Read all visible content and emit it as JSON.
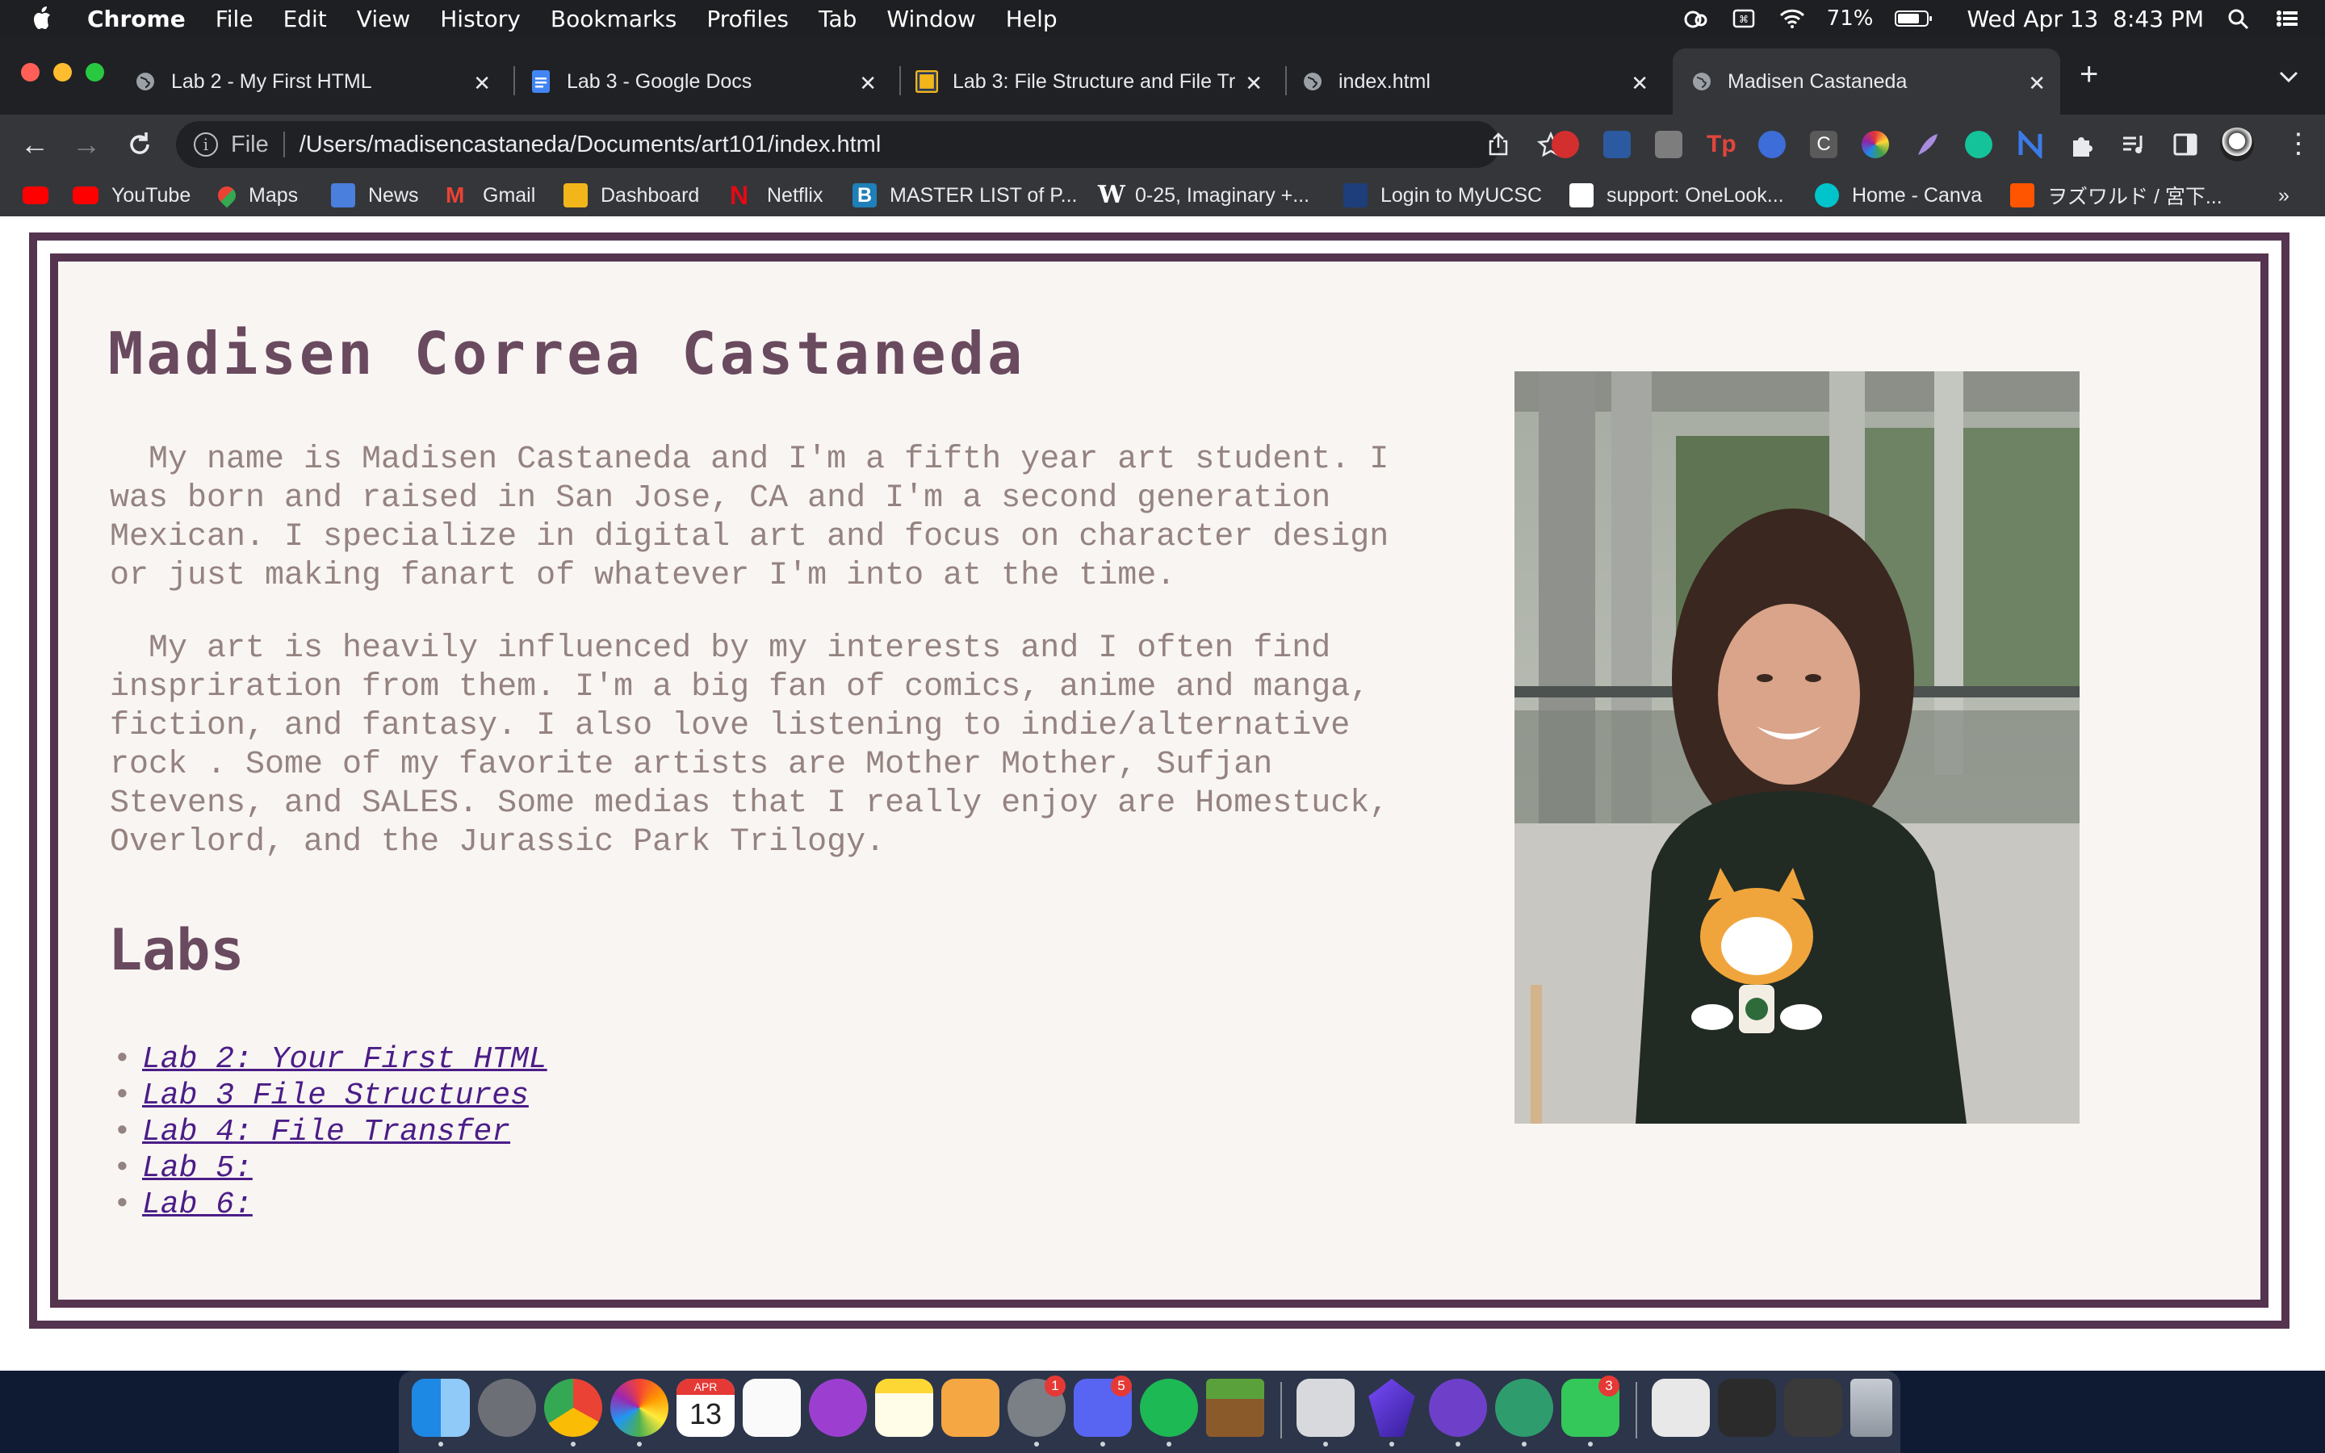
{
  "menubar": {
    "app": "Chrome",
    "items": [
      "File",
      "Edit",
      "View",
      "History",
      "Bookmarks",
      "Profiles",
      "Tab",
      "Window",
      "Help"
    ],
    "battery": "71%",
    "datetime": "Wed Apr 13  8:43 PM"
  },
  "tabs": [
    {
      "title": "Lab 2 - My First HTML",
      "icon": "globe-icon"
    },
    {
      "title": "Lab 3 - Google Docs",
      "icon": "google-docs-icon"
    },
    {
      "title": "Lab 3: File Structure and File Tr",
      "icon": "ucsc-icon"
    },
    {
      "title": "index.html",
      "icon": "globe-icon"
    },
    {
      "title": "Madisen Castaneda",
      "icon": "globe-icon"
    }
  ],
  "omnibox": {
    "scheme": "File",
    "url": "/Users/madisencastaneda/Documents/art101/index.html"
  },
  "bookmarks": [
    "YouTube",
    "Maps",
    "News",
    "Gmail",
    "Dashboard",
    "Netflix",
    "MASTER LIST of P...",
    "0-25, Imaginary +...",
    "Login to MyUCSC",
    "support: OneLook...",
    "Home - Canva",
    "ヲズワルド / 宮下..."
  ],
  "page": {
    "heading": "Madisen Correa Castaneda",
    "para1": "  My name is Madisen Castaneda and I'm a fifth year art student. I\nwas born and raised in San Jose, CA and I'm a second generation\nMexican. I specialize in digital art and focus on character design\nor just making fanart of whatever I'm into at the time.",
    "para2": "  My art is heavily influenced by my interests and I often find\ninspriration from them. I'm a big fan of comics, anime and manga,\nfiction, and fantasy. I also love listening to indie/alternative\nrock . Some of my favorite artists are Mother Mother, Sufjan\nStevens, and SALES. Some medias that I really enjoy are Homestuck,\nOverlord, and the Jurassic Park Trilogy.",
    "labs_heading": "Labs",
    "labs": [
      "Lab 2: Your First HTML",
      "Lab 3 File Structures",
      "Lab 4: File Transfer",
      "Lab 5:",
      "Lab 6:"
    ]
  },
  "dock": {
    "calendar_month": "APR",
    "calendar_day": "13",
    "badges": {
      "system_preferences": "1",
      "discord": "5",
      "facetime": "3"
    }
  },
  "colors": {
    "border": "#55344f",
    "heading": "#6a4a5e",
    "text": "#948380",
    "link": "#4b1d87",
    "page_bg": "#f9f5f3"
  }
}
